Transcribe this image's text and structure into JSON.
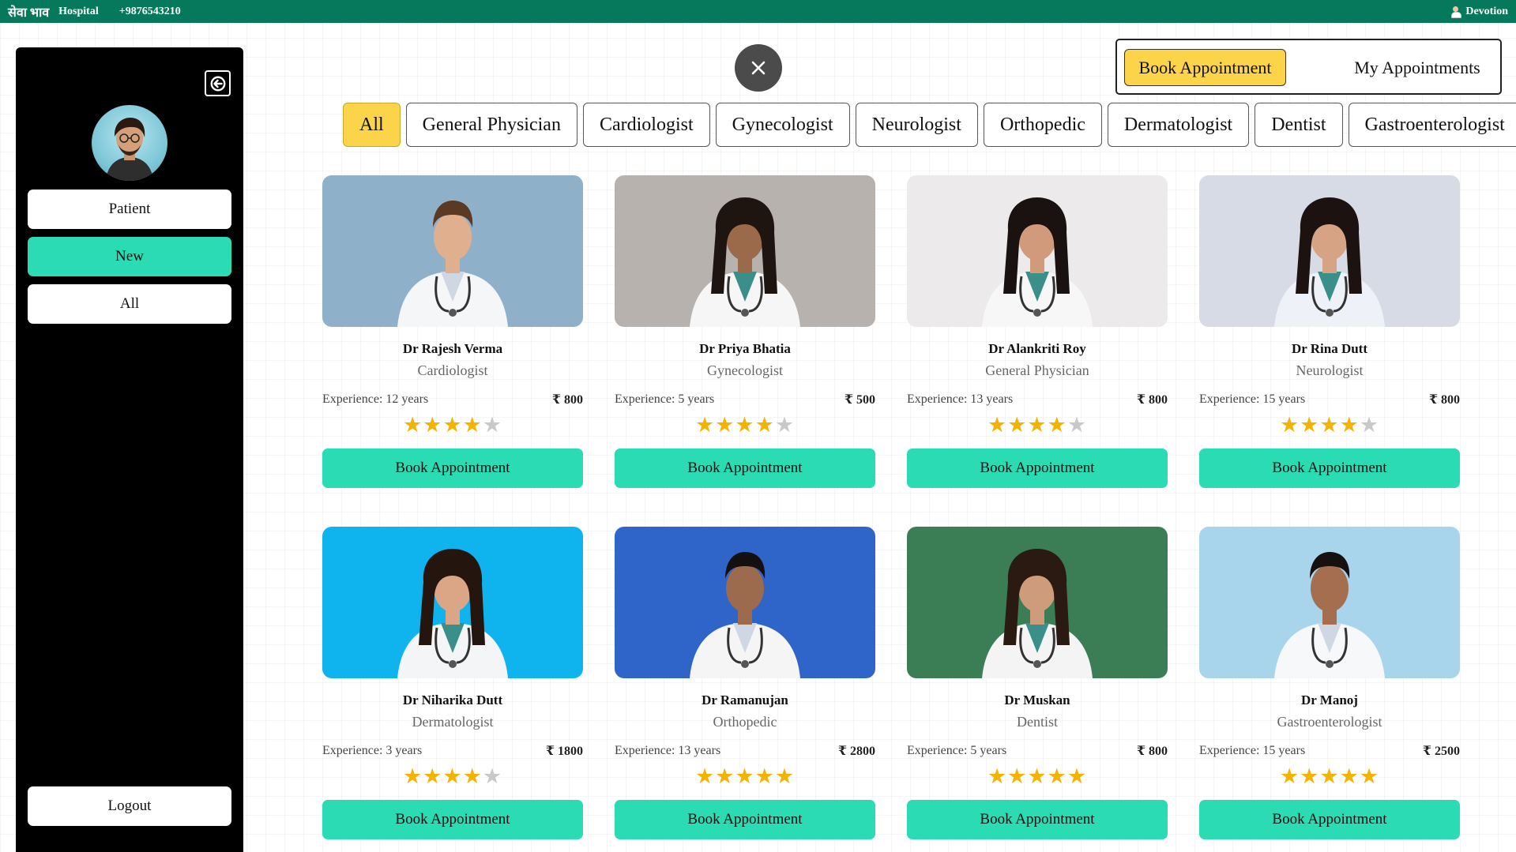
{
  "topbar": {
    "brand": "सेवा भाव",
    "brand_sub": "Hospital",
    "phone": "+9876543210",
    "user_name": "Devotion"
  },
  "sidebar": {
    "items": [
      {
        "label": "Patient",
        "active": false
      },
      {
        "label": "New",
        "active": true
      },
      {
        "label": "All",
        "active": false
      }
    ],
    "logout_label": "Logout"
  },
  "toggle": {
    "book_label": "Book Appointment",
    "my_label": "My Appointments"
  },
  "filters": [
    "All",
    "General Physician",
    "Cardiologist",
    "Gynecologist",
    "Neurologist",
    "Orthopedic",
    "Dermatologist",
    "Dentist",
    "Gastroenterologist"
  ],
  "active_filter": "All",
  "experience_prefix": "Experience:",
  "currency_symbol": "₹",
  "book_button_label": "Book Appointment",
  "doctors": [
    {
      "name": "Dr Rajesh Verma",
      "specialty": "Cardiologist",
      "experience": "12 years",
      "fee": "800",
      "rating": 4,
      "bg": "#8fb0c9",
      "coat": "#f4f6f8",
      "skin": "#e0b08e",
      "hair": "#5a3a22"
    },
    {
      "name": "Dr Priya Bhatia",
      "specialty": "Gynecologist",
      "experience": "5 years",
      "fee": "500",
      "rating": 4,
      "bg": "#b7b2ae",
      "coat": "#f6f6f6",
      "skin": "#9a6a4a",
      "hair": "#1e1410"
    },
    {
      "name": "Dr Alankriti Roy",
      "specialty": "General Physician",
      "experience": "13 years",
      "fee": "800",
      "rating": 4,
      "bg": "#eceaea",
      "coat": "#f7f7f7",
      "skin": "#d19a7a",
      "hair": "#1a1210"
    },
    {
      "name": "Dr Rina Dutt",
      "specialty": "Neurologist",
      "experience": "15 years",
      "fee": "800",
      "rating": 4,
      "bg": "#d6dbe6",
      "coat": "#eef2f8",
      "skin": "#d6a384",
      "hair": "#1c1311"
    },
    {
      "name": "Dr Niharika Dutt",
      "specialty": "Dermatologist",
      "experience": "3 years",
      "fee": "1800",
      "rating": 4,
      "bg": "#0fb4ee",
      "coat": "#f3f5f7",
      "skin": "#dba686",
      "hair": "#24160f"
    },
    {
      "name": "Dr Ramanujan",
      "specialty": "Orthopedic",
      "experience": "13 years",
      "fee": "2800",
      "rating": 5,
      "bg": "#2f64c9",
      "coat": "#f5f5f5",
      "skin": "#9c6a4c",
      "hair": "#141010"
    },
    {
      "name": "Dr Muskan",
      "specialty": "Dentist",
      "experience": "5 years",
      "fee": "800",
      "rating": 5,
      "bg": "#3b7d55",
      "coat": "#f4f4f4",
      "skin": "#cf9c7b",
      "hair": "#2a1a12"
    },
    {
      "name": "Dr Manoj",
      "specialty": "Gastroenterologist",
      "experience": "15 years",
      "fee": "2500",
      "rating": 5,
      "bg": "#a8d4ec",
      "coat": "#f6f8fa",
      "skin": "#a56f4f",
      "hair": "#16110e"
    }
  ]
}
